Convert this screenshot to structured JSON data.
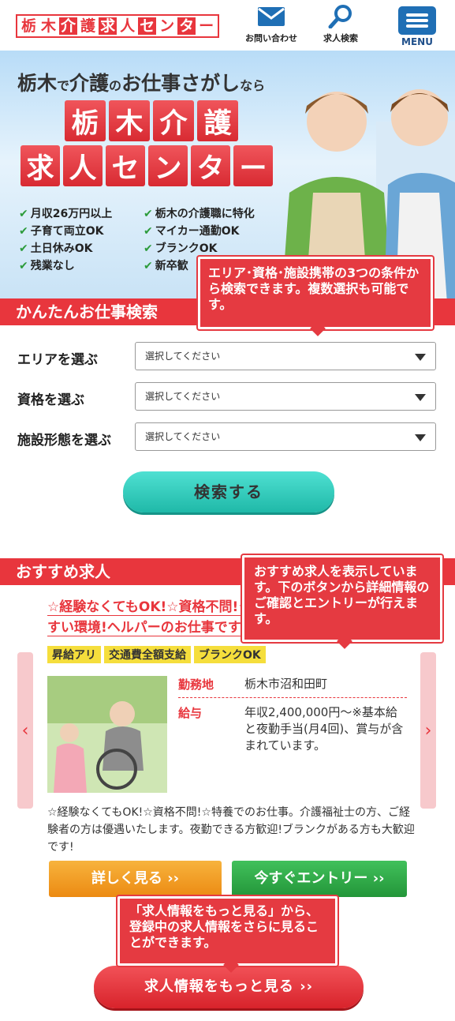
{
  "header": {
    "logo_chars": [
      "栃",
      "木",
      "介",
      "護",
      "求",
      "人",
      "セ",
      "ン",
      "タ",
      "ー"
    ],
    "contact_label": "お問い合わせ",
    "search_label": "求人検索",
    "menu_label": "MENU"
  },
  "hero": {
    "tagline_part1": "栃木",
    "tagline_small1": "で",
    "tagline_part2": "介護",
    "tagline_small2": "の",
    "tagline_part3": "お仕事さがし",
    "tagline_small3": "なら",
    "title_row1": [
      "栃",
      "木",
      "介",
      "護"
    ],
    "title_row2": [
      "求",
      "人",
      "セ",
      "ン",
      "タ",
      "ー"
    ],
    "features": [
      "月収26万円以上",
      "栃木の介護職に特化",
      "子育て両立OK",
      "マイカー通勤OK",
      "土日休みOK",
      "ブランクOK",
      "残業なし",
      "新卒歓"
    ]
  },
  "callouts": {
    "search_note": "エリア･資格･施設携帯の3つの条件から検索できます。複数選択も可能です。",
    "recommend_note": "おすすめ求人を表示しています。下のボタンから詳細情報のご確認とエントリーが行えます。",
    "more_note": "「求人情報をもっと見る」から、登録中の求人情報をさらに見ることができます。"
  },
  "search": {
    "heading": "かんたんお仕事検索",
    "area_label": "エリアを選ぶ",
    "license_label": "資格を選ぶ",
    "facility_label": "施設形態を選ぶ",
    "placeholder": "選択してください",
    "button": "検索する"
  },
  "recommend": {
    "heading": "おすすめ求人",
    "job_title": "☆経験なくてもOK!☆資格不問!☆特養でのお仕事。働きやすい環境!ヘルパーのお仕事です",
    "tags": [
      "昇給アリ",
      "交通費全額支給",
      "ブランクOK"
    ],
    "location_key": "勤務地",
    "location_value": "栃木市沼和田町",
    "salary_key": "給与",
    "salary_value": "年収2,400,000円～※基本給と夜勤手当(月4回)、賞与が含まれています。",
    "description": "☆経験なくてもOK!☆資格不問!☆特養でのお仕事。介護福祉士の方、ご経験者の方は優遇いたします。夜勤できる方歓迎!ブランクがある方も大歓迎です!",
    "detail_button": "詳しく見る ››",
    "entry_button": "今すぐエントリー ››",
    "prev_arrow": "‹",
    "next_arrow": "›"
  },
  "more_button": "求人情報をもっと見る ››",
  "colors": {
    "brand_red": "#e8363d",
    "teal": "#1fb9a8",
    "orange": "#ec8a12",
    "green": "#239639",
    "menu_blue": "#1f6fb5"
  }
}
